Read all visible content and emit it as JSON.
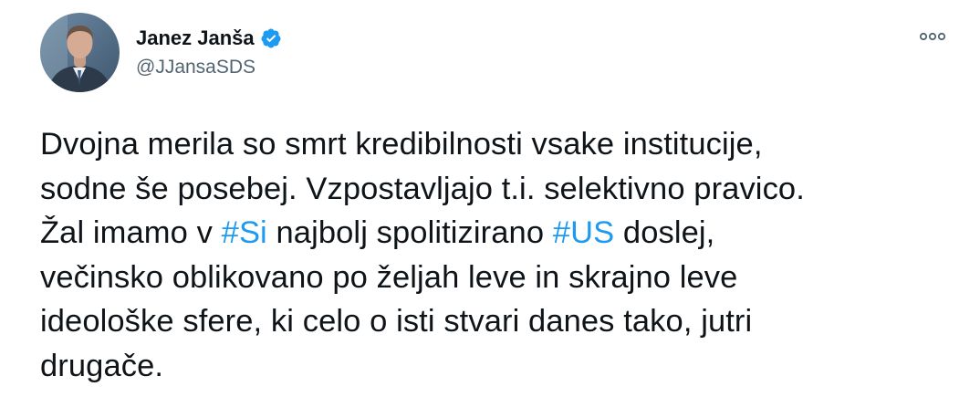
{
  "author": {
    "display_name": "Janez Janša",
    "handle": "@JJansaSDS",
    "verified": true,
    "avatar_icon": "profile-photo"
  },
  "menu": {
    "icon": "more-options-icon"
  },
  "tweet": {
    "line1": "Dvojna merila so smrt kredibilnosti vsake institucije,",
    "line2": "sodne še posebej. Vzpostavljajo t.i. selektivno pravico.",
    "line3_a": "Žal imamo v ",
    "hashtag1": "#Si",
    "line3_b": " najbolj spolitizirano ",
    "hashtag2": "#US",
    "line3_c": " doslej,",
    "line4": "večinsko oblikovano po željah leve in skrajno leve",
    "line5": "ideološke sfere, ki celo o isti stvari danes tako, jutri",
    "line6": "drugače."
  },
  "colors": {
    "hashtag": "#1d9bf0",
    "verified_badge": "#1d9bf0",
    "secondary_text": "#536471",
    "primary_text": "#0f1419"
  }
}
